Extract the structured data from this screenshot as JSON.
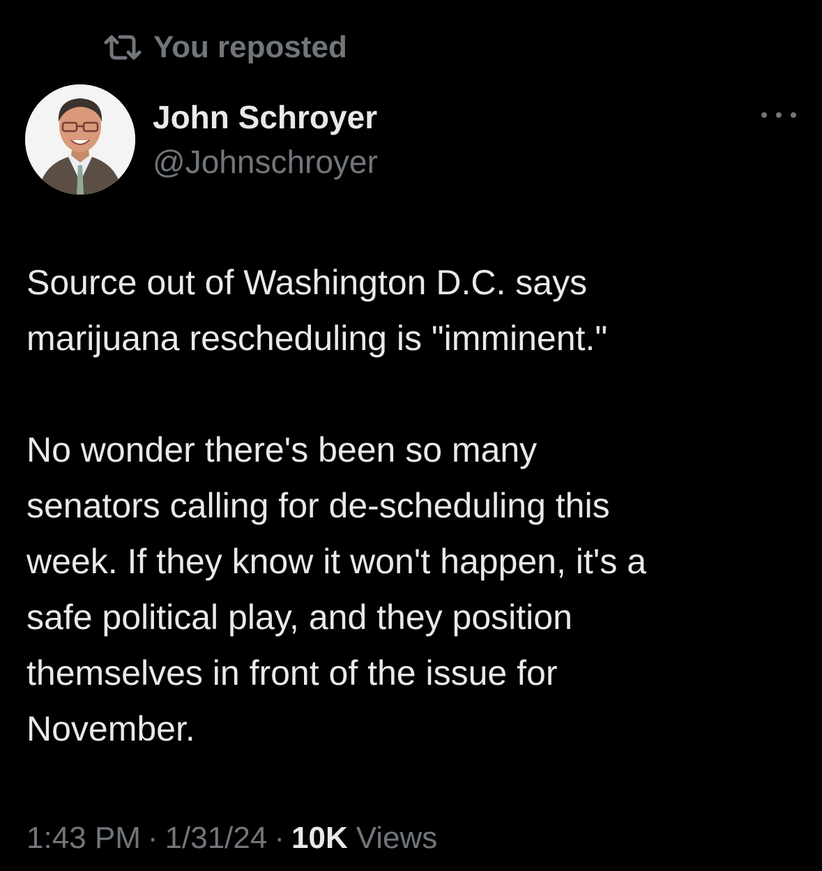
{
  "repost_banner": {
    "icon": "repost-icon",
    "label": "You reposted"
  },
  "author": {
    "display_name": "John Schroyer",
    "handle": "@Johnschroyer",
    "avatar": "avatar-photo"
  },
  "more_menu": {
    "icon": "more-horizontal-icon"
  },
  "tweet": {
    "lines": [
      "Source out of Washington D.C. says",
      "marijuana rescheduling is \"imminent.\"",
      "",
      "No wonder there's been so many",
      "senators calling for de-scheduling this",
      "week. If they know it won't happen, it's a",
      "safe political play, and they position",
      "themselves in front of the issue for",
      "November."
    ]
  },
  "meta": {
    "time": "1:43 PM",
    "separator": "·",
    "date": "1/31/24",
    "views_count": "10K",
    "views_label": "Views"
  },
  "colors": {
    "background": "#000000",
    "primary_text": "#e7e9ea",
    "secondary_text": "#71767b"
  }
}
